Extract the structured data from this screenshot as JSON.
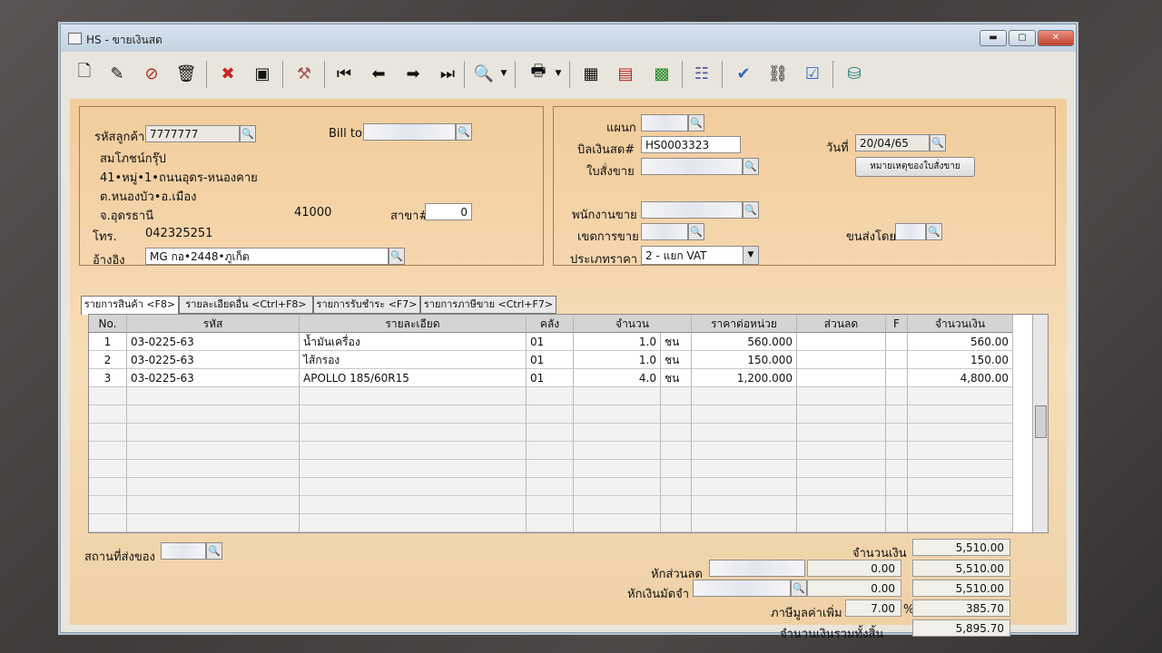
{
  "window": {
    "title": "HS - ขายเงินสด",
    "min_label": "▬",
    "max_label": "▢",
    "close_label": "✕"
  },
  "toolbar": {
    "icons": [
      "new-document-icon",
      "edit-document-icon",
      "cancel-document-icon",
      "trash-icon",
      "delete-icon",
      "save-icon",
      "tools-icon",
      "first-record-icon",
      "previous-record-icon",
      "next-record-icon",
      "last-record-icon",
      "search-document-icon",
      "print-icon",
      "print-preview-icon",
      "report-icon",
      "calculator-icon",
      "document-list-icon",
      "ok-icon",
      "link-icon",
      "ok-stamp-icon",
      "database-icon"
    ]
  },
  "customer": {
    "code_label": "รหัสลูกค้า",
    "code_value": "7777777",
    "billto_label": "Bill to",
    "billto_value": "",
    "name": "สมโภชน์กรุ๊ป",
    "addr1": "41•หมู่•1•ถนนอุดร-หนองคาย",
    "addr2": "ต.หนองบัว•อ.เมือง",
    "addr3": "จ.อุดรธานี",
    "zip": "41000",
    "branch_label": "สาขา#",
    "branch_value": "0",
    "phone_label": "โทร.",
    "phone_value": "042325251",
    "ref_label": "อ้างอิง",
    "ref_value": "MG กอ•2448•ภูเก็ต"
  },
  "doc": {
    "dept_label": "แผนก",
    "dept_value": "",
    "cashbill_label": "บิลเงินสด#",
    "cashbill_value": "HS0003323",
    "so_label": "ใบสั่งขาย",
    "so_value": "",
    "date_label": "วันที่",
    "date_value": "20/04/65",
    "note_button": "หมายเหตุของใบสั่งขาย",
    "salesman_label": "พนักงานขาย",
    "salesman_value": "",
    "area_label": "เขตการขาย",
    "area_value": "",
    "shipby_label": "ขนส่งโดย",
    "shipby_value": "",
    "pricetype_label": "ประเภทราคา",
    "pricetype_value": "2 - แยก VAT"
  },
  "tabs": [
    "รายการสินค้า <F8>",
    "รายละเอียดอื่น <Ctrl+F8>",
    "รายการรับชำระ <F7>",
    "รายการภาษีขาย <Ctrl+F7>"
  ],
  "grid": {
    "headers": [
      "No.",
      "รหัส",
      "รายละเอียด",
      "คลัง",
      "จำนวน",
      "ราคาต่อหน่วย",
      "ส่วนลด",
      "F",
      "จำนวนเงิน"
    ],
    "rows": [
      {
        "no": "1",
        "code": "03-0225-63",
        "desc": "น้ำมันเครื่อง",
        "wh": "01",
        "qty": "1.0",
        "unit": "ชน",
        "price": "560.000",
        "disc": "",
        "f": "",
        "amount": "560.00"
      },
      {
        "no": "2",
        "code": "03-0225-63",
        "desc": "ไส้กรอง",
        "wh": "01",
        "qty": "1.0",
        "unit": "ชน",
        "price": "150.000",
        "disc": "",
        "f": "",
        "amount": "150.00"
      },
      {
        "no": "3",
        "code": "03-0225-63",
        "desc": "APOLLO 185/60R15",
        "wh": "01",
        "qty": "4.0",
        "unit": "ชน",
        "price": "1,200.000",
        "disc": "",
        "f": "",
        "amount": "4,800.00"
      }
    ]
  },
  "footer": {
    "ship_place_label": "สถานที่ส่งของ",
    "amount_label": "จำนวนเงิน",
    "amount_value": "5,510.00",
    "discount_label": "หักส่วนลด",
    "discount_value": "0.00",
    "after_discount": "5,510.00",
    "deposit_label": "หักเงินมัดจำ",
    "deposit_value": "0.00",
    "after_deposit": "5,510.00",
    "vat_label": "ภาษีมูลค่าเพิ่ม",
    "vat_rate": "7.00",
    "vat_pct": "%",
    "vat_value": "385.70",
    "total_label": "จำนวนเงินรวมทั้งสิ้น",
    "total_value": "5,895.70"
  }
}
